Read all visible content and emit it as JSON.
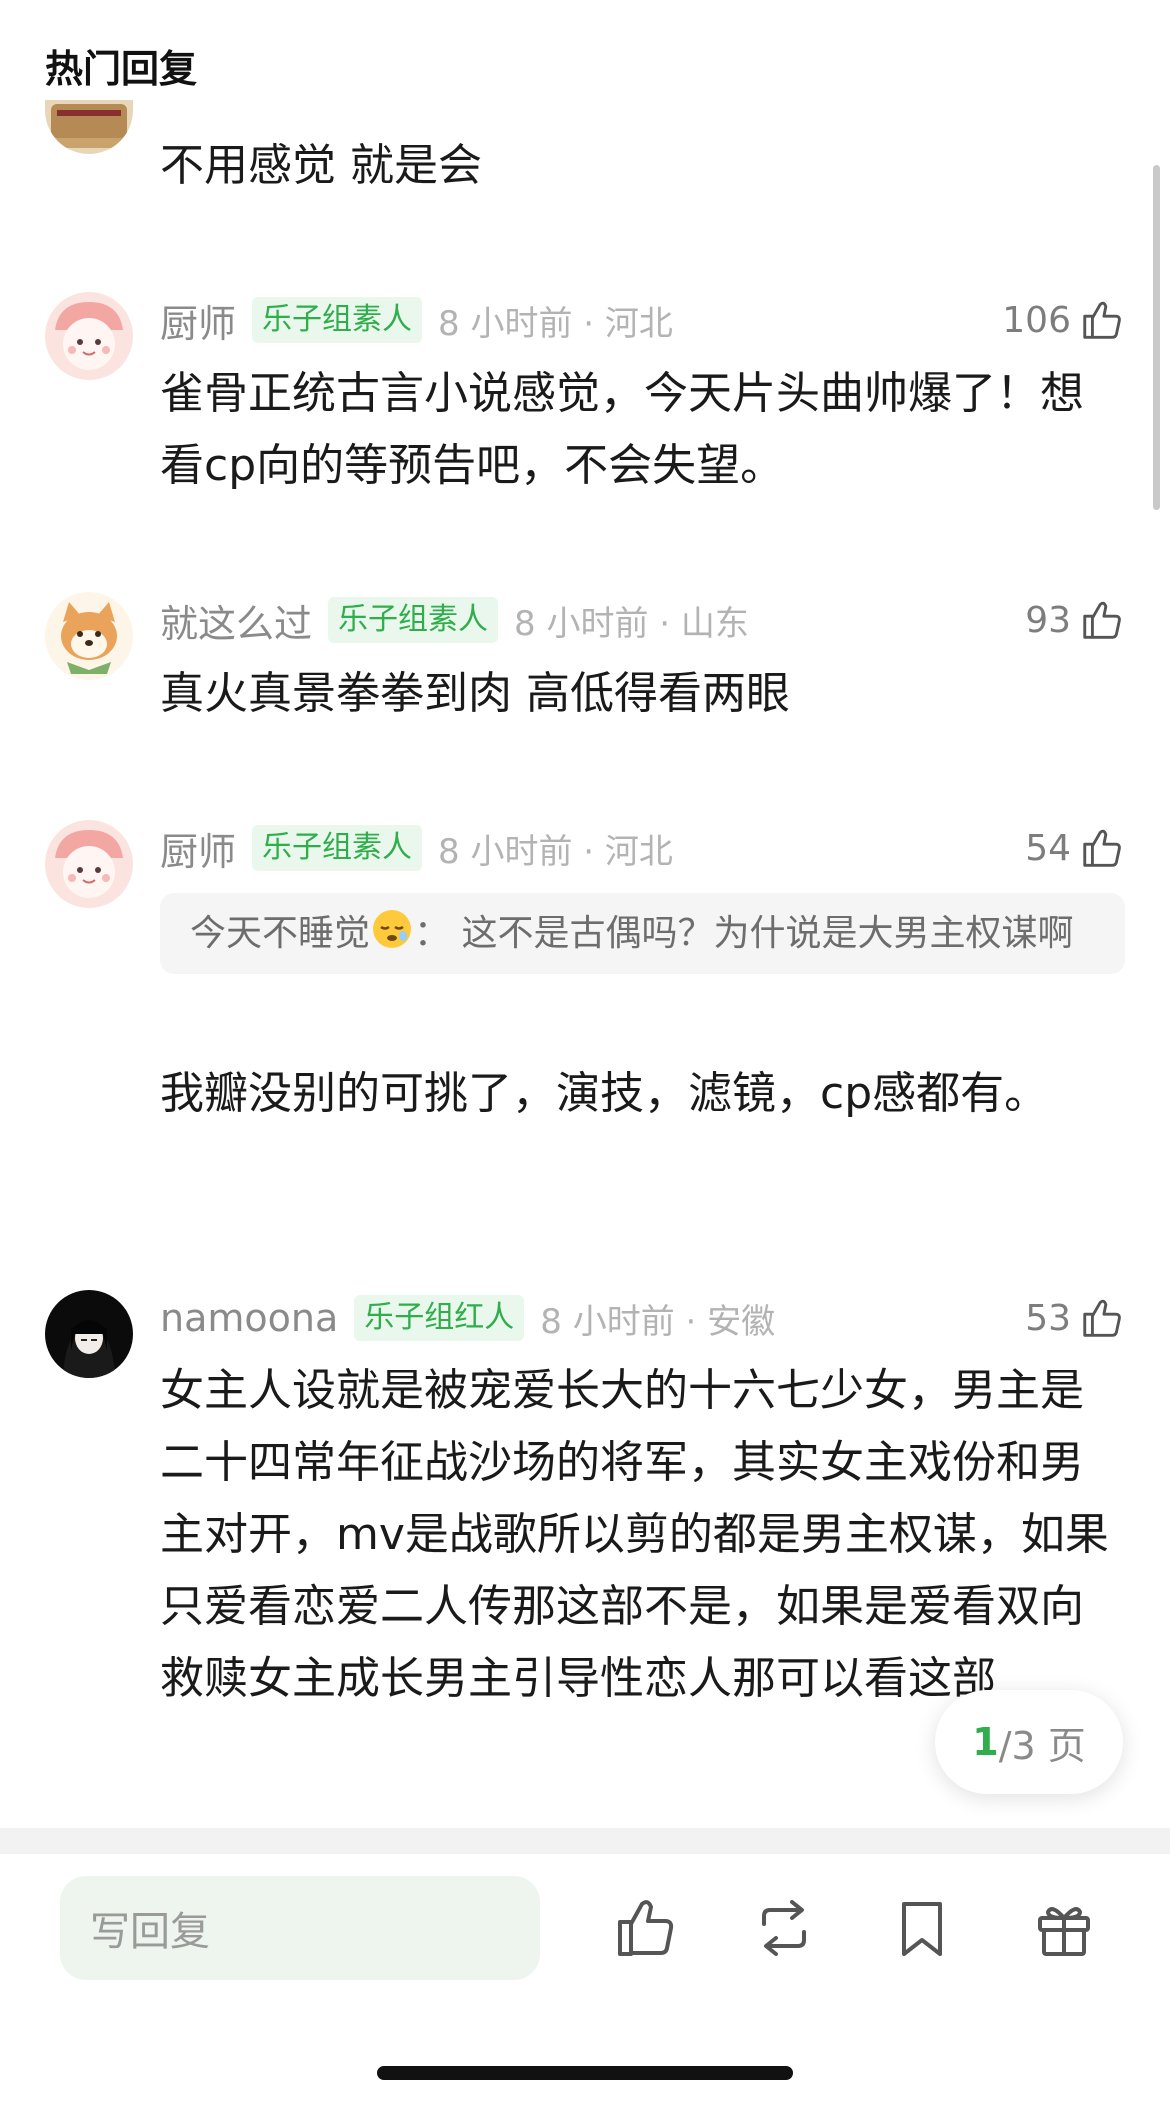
{
  "header": {
    "title": "热门回复"
  },
  "comments": [
    {
      "text": "不用感觉 就是会"
    },
    {
      "username": "厨师",
      "badge": "乐子组素人",
      "time": "8 小时前 · 河北",
      "likes": "106",
      "text": "雀骨正统古言小说感觉，今天片头曲帅爆了！想看cp向的等预告吧，不会失望。"
    },
    {
      "username": "就这么过",
      "badge": "乐子组素人",
      "time": "8 小时前 · 山东",
      "likes": "93",
      "text": "真火真景拳拳到肉 高低得看两眼"
    },
    {
      "username": "厨师",
      "badge": "乐子组素人",
      "time": "8 小时前 · 河北",
      "likes": "54",
      "quote_author": "今天不睡觉",
      "quote_text": "： 这不是古偶吗？为什说是大男主权谋啊",
      "text": "我瓣没别的可挑了，演技，滤镜，cp感都有。"
    },
    {
      "username": "namoona",
      "badge": "乐子组红人",
      "time": "8 小时前 · 安徽",
      "likes": "53",
      "text": "女主人设就是被宠爱长大的十六七少女，男主是二十四常年征战沙场的将军，其实女主戏份和男主对开，mv是战歌所以剪的都是男主权谋，如果只爱看恋爱二人传那这部不是，如果是爱看双向救赎女主成长男主引导性恋人那可以看这部"
    }
  ],
  "pagination": {
    "current": "1",
    "total": "/3 页"
  },
  "bottom_bar": {
    "reply_placeholder": "写回复",
    "icons": [
      "like-icon",
      "repost-icon",
      "bookmark-icon",
      "gift-icon"
    ]
  },
  "colors": {
    "accent_green": "#2fae4b",
    "badge_bg": "#eaf7ec",
    "meta_gray": "#8a8a8a",
    "quote_bg": "#f5f5f5"
  }
}
